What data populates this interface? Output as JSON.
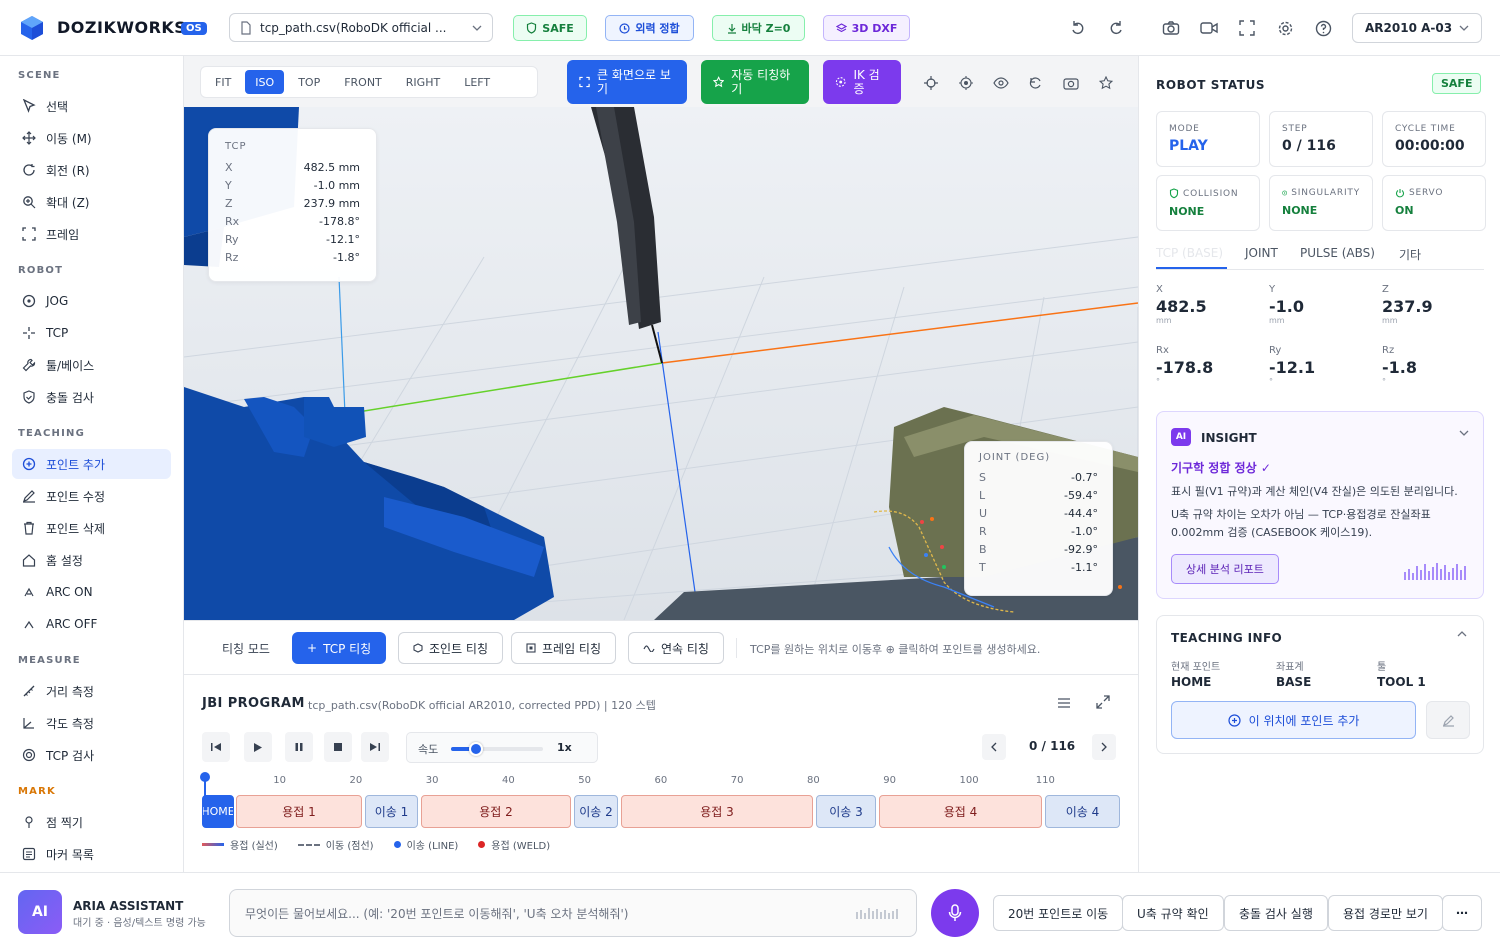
{
  "header": {
    "brand": "DOZIKWORKS",
    "version": "OS",
    "file_select": "tcp_path.csv(RoboDK official ...",
    "badges": {
      "safe": "SAFE",
      "ext": "외력 정합",
      "floor": "바닥 Z=0",
      "dxf": "3D DXF"
    },
    "robot_select": "AR2010 A-03"
  },
  "sidebar": {
    "scene_title": "SCENE",
    "scene": [
      "선택",
      "이동 (M)",
      "회전 (R)",
      "확대 (Z)",
      "프레임"
    ],
    "robot_title": "ROBOT",
    "robot": [
      "JOG",
      "TCP",
      "툴/베이스",
      "충돌 검사"
    ],
    "teaching_title": "TEACHING",
    "teaching": [
      "포인트 추가",
      "포인트 수정",
      "포인트 삭제",
      "홈 설정",
      "ARC ON",
      "ARC OFF"
    ],
    "measure_title": "MEASURE",
    "measure": [
      "거리 측정",
      "각도 측정",
      "TCP 검사"
    ],
    "mark_title": "MARK",
    "mark": [
      "점 찍기",
      "마커 목록"
    ]
  },
  "viewbar": {
    "views": [
      "FIT",
      "ISO",
      "TOP",
      "FRONT",
      "RIGHT",
      "LEFT"
    ],
    "fullscreen": "큰 화면으로 보기",
    "auto_teach": "자동 티칭하기",
    "ik": "IK 검증"
  },
  "tcp_card": {
    "title": "TCP",
    "rows": [
      {
        "k": "X",
        "v": "482.5 mm"
      },
      {
        "k": "Y",
        "v": "-1.0 mm"
      },
      {
        "k": "Z",
        "v": "237.9 mm"
      },
      {
        "k": "Rx",
        "v": "-178.8°"
      },
      {
        "k": "Ry",
        "v": "-12.1°"
      },
      {
        "k": "Rz",
        "v": "-1.8°"
      }
    ]
  },
  "joint_card": {
    "title": "JOINT (DEG)",
    "rows": [
      {
        "k": "S",
        "v": "-0.7°"
      },
      {
        "k": "L",
        "v": "-59.4°"
      },
      {
        "k": "U",
        "v": "-44.4°"
      },
      {
        "k": "R",
        "v": "-1.0°"
      },
      {
        "k": "B",
        "v": "-92.9°"
      },
      {
        "k": "T",
        "v": "-1.1°"
      }
    ]
  },
  "teachbar": {
    "mode": "티칭 모드",
    "tcp": "TCP 티칭",
    "joint": "조인트 티칭",
    "frame": "프레임 티칭",
    "continuous": "연속 티칭",
    "hint": "TCP를 원하는 위치로 이동후 ⊕ 클릭하여 포인트를 생성하세요."
  },
  "program": {
    "title": "JBI PROGRAM",
    "subtitle": "tcp_path.csv(RoboDK official AR2010, corrected PPD) | 120 스텝",
    "speed_label": "속도",
    "speed_value": "1x",
    "speed_fraction": 0.27,
    "counter": "0 / 116",
    "ticks": [
      "10",
      "20",
      "30",
      "40",
      "50",
      "60",
      "70",
      "80",
      "90",
      "100",
      "110"
    ],
    "segments": [
      {
        "label": "HOME",
        "type": "home"
      },
      {
        "label": "용접 1",
        "type": "weld"
      },
      {
        "label": "이송 1",
        "type": "move"
      },
      {
        "label": "용접 2",
        "type": "weld"
      },
      {
        "label": "이송 2",
        "type": "move"
      },
      {
        "label": "용접 3",
        "type": "weld"
      },
      {
        "label": "이송 3",
        "type": "move"
      },
      {
        "label": "용접 4",
        "type": "weld"
      },
      {
        "label": "이송 4",
        "type": "move"
      }
    ],
    "legend": [
      "용접 (실선)",
      "이동 (점선)",
      "이송 (LINE)",
      "용접 (WELD)"
    ]
  },
  "robot_status": {
    "title": "ROBOT STATUS",
    "badge": "SAFE",
    "mode_label": "MODE",
    "mode_value": "PLAY",
    "step_label": "STEP",
    "step_value": "0 / 116",
    "cycle_label": "CYCLE TIME",
    "cycle_value": "00:00:00",
    "collision_label": "COLLISION",
    "collision_value": "NONE",
    "singularity_label": "SINGULARITY",
    "singularity_value": "NONE",
    "servo_label": "SERVO",
    "servo_value": "ON"
  },
  "coord_tabs": [
    "TCP (BASE)",
    "JOINT",
    "PULSE (ABS)",
    "기타"
  ],
  "coords": [
    {
      "l": "X",
      "v": "482.5",
      "u": "mm"
    },
    {
      "l": "Y",
      "v": "-1.0",
      "u": "mm"
    },
    {
      "l": "Z",
      "v": "237.9",
      "u": "mm"
    },
    {
      "l": "Rx",
      "v": "-178.8",
      "u": "°"
    },
    {
      "l": "Ry",
      "v": "-12.1",
      "u": "°"
    },
    {
      "l": "Rz",
      "v": "-1.8",
      "u": "°"
    }
  ],
  "insight": {
    "badge": "AI",
    "title": "INSIGHT",
    "headline": "기구학 정합 정상 ✓",
    "p1": "표시 필(V1 규약)과 계산 체인(V4 잔실)은 의도된 분리입니다.",
    "p2": "U축 규약 차이는 오차가 아님 — TCP·용접경로 잔실좌표 0.002mm 검증 (CASEBOOK 케이스19).",
    "button": "상세 분석 리포트"
  },
  "teaching_info": {
    "title": "TEACHING INFO",
    "labels": [
      "현재 포인트",
      "좌표계",
      "툴"
    ],
    "values": [
      "HOME",
      "BASE",
      "TOOL 1"
    ],
    "add_button": "이 위치에 포인트 추가"
  },
  "assistant": {
    "badge": "AI",
    "name": "ARIA ASSISTANT",
    "status": "대기 중 · 음성/텍스트 명령 가능",
    "placeholder": "무엇이든 물어보세요... (예: '20번 포인트로 이동해줘', 'U축 오차 분석해줘')",
    "quick": [
      "20번 포인트로 이동",
      "U축 규약 확인",
      "충돌 검사 실행",
      "용접 경로만 보기"
    ],
    "more": "⋯"
  },
  "colors": {
    "accent": "#2563eb",
    "green": "#16a34a",
    "purple": "#7c3aed",
    "weld": "#fde2dc",
    "move": "#dde7f7"
  }
}
